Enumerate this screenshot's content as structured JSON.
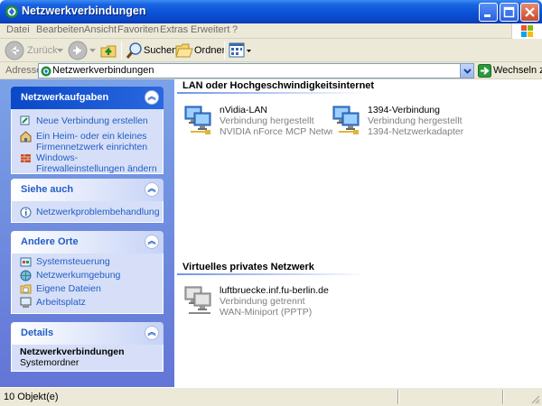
{
  "window": {
    "title": "Netzwerkverbindungen",
    "controls": {
      "minimize": "–",
      "maximize": "□",
      "close": "✕"
    }
  },
  "menu": [
    "Datei",
    "Bearbeiten",
    "Ansicht",
    "Favoriten",
    "Extras",
    "Erweitert",
    "?"
  ],
  "toolbar": {
    "back_label": "Zurück",
    "search_label": "Suchen",
    "folders_label": "Ordner"
  },
  "address": {
    "label": "Adresse",
    "value": "Netzwerkverbindungen",
    "go_label": "Wechseln zu"
  },
  "sidebar": {
    "network_tasks": {
      "title": "Netzwerkaufgaben",
      "items": [
        {
          "label": "Neue Verbindung erstellen",
          "icon": "new-connection-icon"
        },
        {
          "label": "Ein Heim- oder ein kleines Firmennetzwerk einrichten",
          "icon": "home-network-icon"
        },
        {
          "label": "Windows-Firewalleinstellungen ändern",
          "icon": "firewall-icon"
        }
      ]
    },
    "see_also": {
      "title": "Siehe auch",
      "items": [
        {
          "label": "Netzwerkproblembehandlung",
          "icon": "info-icon"
        }
      ]
    },
    "other_places": {
      "title": "Andere Orte",
      "items": [
        {
          "label": "Systemsteuerung",
          "icon": "control-panel-icon"
        },
        {
          "label": "Netzwerkumgebung",
          "icon": "network-places-icon"
        },
        {
          "label": "Eigene Dateien",
          "icon": "my-documents-icon"
        },
        {
          "label": "Arbeitsplatz",
          "icon": "my-computer-icon"
        }
      ]
    },
    "details": {
      "title": "Details",
      "name": "Netzwerkverbindungen",
      "type": "Systemordner"
    }
  },
  "groups": {
    "lan": {
      "title": "LAN oder Hochgeschwindigkeitsinternet",
      "connections": [
        {
          "name": "nVidia-LAN",
          "status": "Verbindung hergestellt",
          "device": "NVIDIA nForce MCP Networkin..."
        },
        {
          "name": "1394-Verbindung",
          "status": "Verbindung hergestellt",
          "device": "1394-Netzwerkadapter"
        }
      ]
    },
    "vpn": {
      "title": "Virtuelles privates Netzwerk",
      "connections": [
        {
          "name": "luftbruecke.inf.fu-berlin.de",
          "status": "Verbindung getrennt",
          "device": "WAN-Miniport (PPTP)"
        }
      ]
    }
  },
  "status": {
    "text": "10 Objekt(e)"
  },
  "colors": {
    "title_blue": "#0a52d8",
    "link_blue": "#215dc6",
    "pane_blue": "#7ba2e7",
    "chrome": "#ece9d8"
  }
}
